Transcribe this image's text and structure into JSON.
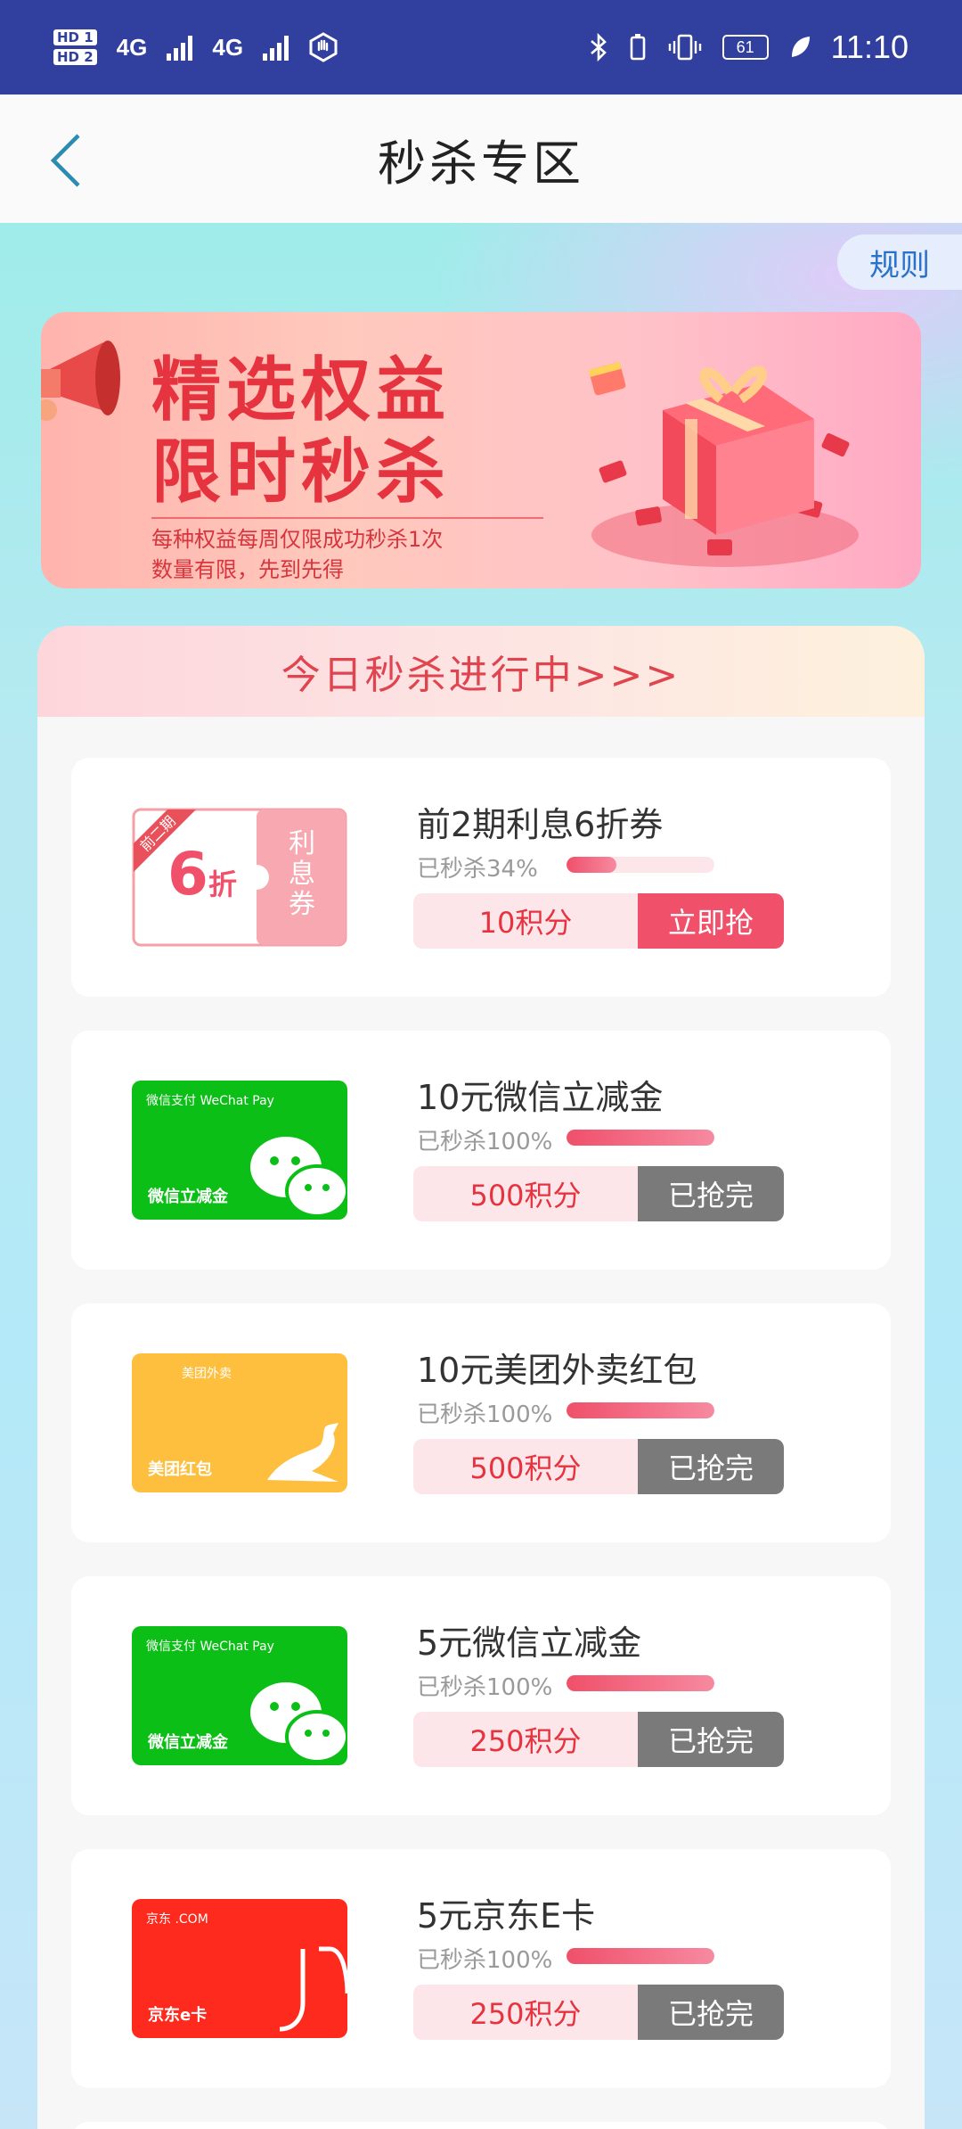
{
  "status_bar": {
    "hd1": "HD 1",
    "hd2": "HD 2",
    "net1": "4G",
    "net2": "4G",
    "battery": "61",
    "time": "11:10"
  },
  "nav": {
    "title": "秒杀专区"
  },
  "rules_label": "规则",
  "banner": {
    "title_line1": "精选权益",
    "title_line2": "限时秒杀",
    "subtitle_line1": "每种权益每周仅限成功秒杀1次",
    "subtitle_line2": "数量有限，先到先得"
  },
  "panel": {
    "heading": "今日秒杀进行中>>>"
  },
  "items": [
    {
      "title": "前2期利息6折券",
      "sold_label": "已秒杀34%",
      "progress": 0.34,
      "points": "10积分",
      "action": "立即抢",
      "image": "coupon",
      "coupon_tag": "前二期",
      "coupon_discount": "6",
      "coupon_unit": "折",
      "coupon_text": "利息券"
    },
    {
      "title": "10元微信立减金",
      "sold_label": "已秒杀100%",
      "progress": 1.0,
      "points": "500积分",
      "action": "已抢完",
      "image": "wechat",
      "image_brand": "微信支付 WeChat Pay",
      "image_label": "微信立减金"
    },
    {
      "title": "10元美团外卖红包",
      "sold_label": "已秒杀100%",
      "progress": 1.0,
      "points": "500积分",
      "action": "已抢完",
      "image": "meituan",
      "image_brand": "美团外卖",
      "image_label": "美团红包"
    },
    {
      "title": "5元微信立减金",
      "sold_label": "已秒杀100%",
      "progress": 1.0,
      "points": "250积分",
      "action": "已抢完",
      "image": "wechat",
      "image_brand": "微信支付 WeChat Pay",
      "image_label": "微信立减金"
    },
    {
      "title": "5元京东E卡",
      "sold_label": "已秒杀100%",
      "progress": 1.0,
      "points": "250积分",
      "action": "已抢完",
      "image": "jd",
      "image_brand": "京东 .COM",
      "image_label": "京东e卡"
    }
  ],
  "colors": {
    "status_bar": "#31409e",
    "accent": "#f0506a",
    "done": "#7a7a7a",
    "wechat_green": "#0bbf16",
    "meituan_yellow": "#ffbf3e",
    "jd_red": "#ff2a1e"
  }
}
